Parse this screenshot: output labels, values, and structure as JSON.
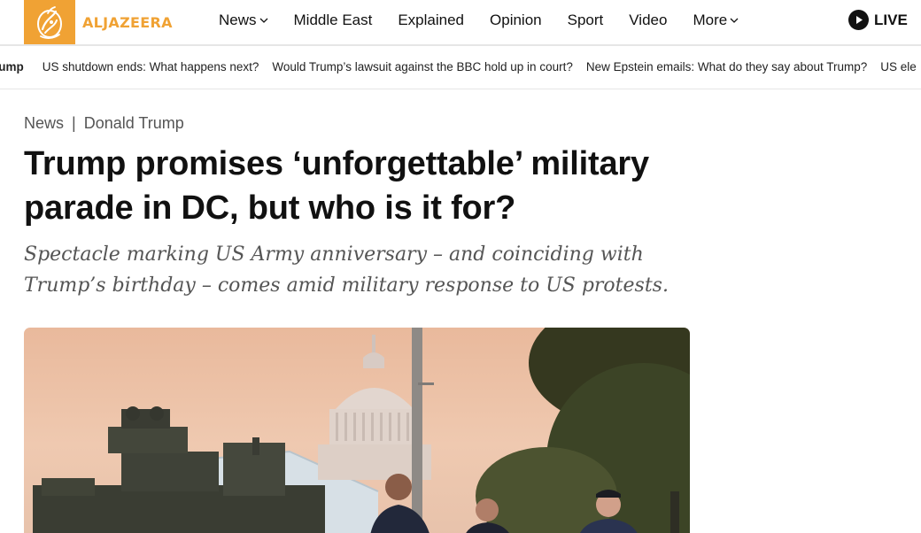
{
  "header": {
    "logo_text": "ALJAZEERA",
    "logo_icon": "aljazeera-calligraphy-logo",
    "nav": [
      {
        "label": "News",
        "dropdown": true
      },
      {
        "label": "Middle East",
        "dropdown": false
      },
      {
        "label": "Explained",
        "dropdown": false
      },
      {
        "label": "Opinion",
        "dropdown": false
      },
      {
        "label": "Sport",
        "dropdown": false
      },
      {
        "label": "Video",
        "dropdown": false
      },
      {
        "label": "More",
        "dropdown": true
      }
    ],
    "live_label": "LIVE",
    "live_icon": "play-icon"
  },
  "trending": [
    "rump",
    "US shutdown ends: What happens next?",
    "Would Trump’s lawsuit against the BBC hold up in court?",
    "New Epstein emails: What do they say about Trump?",
    "US ele"
  ],
  "article": {
    "breadcrumb": [
      "News",
      "Donald Trump"
    ],
    "breadcrumb_separator": "|",
    "headline": "Trump promises ‘unforgettable’ military parade in DC, but who is it for?",
    "subheadline": "Spectacle marking US Army anniversary – and coinciding with Trump’s birthday – comes amid military response to US protests."
  },
  "colors": {
    "brand": "#f0a234",
    "text": "#111111",
    "muted": "#555555",
    "divider": "#e6e6e6"
  }
}
